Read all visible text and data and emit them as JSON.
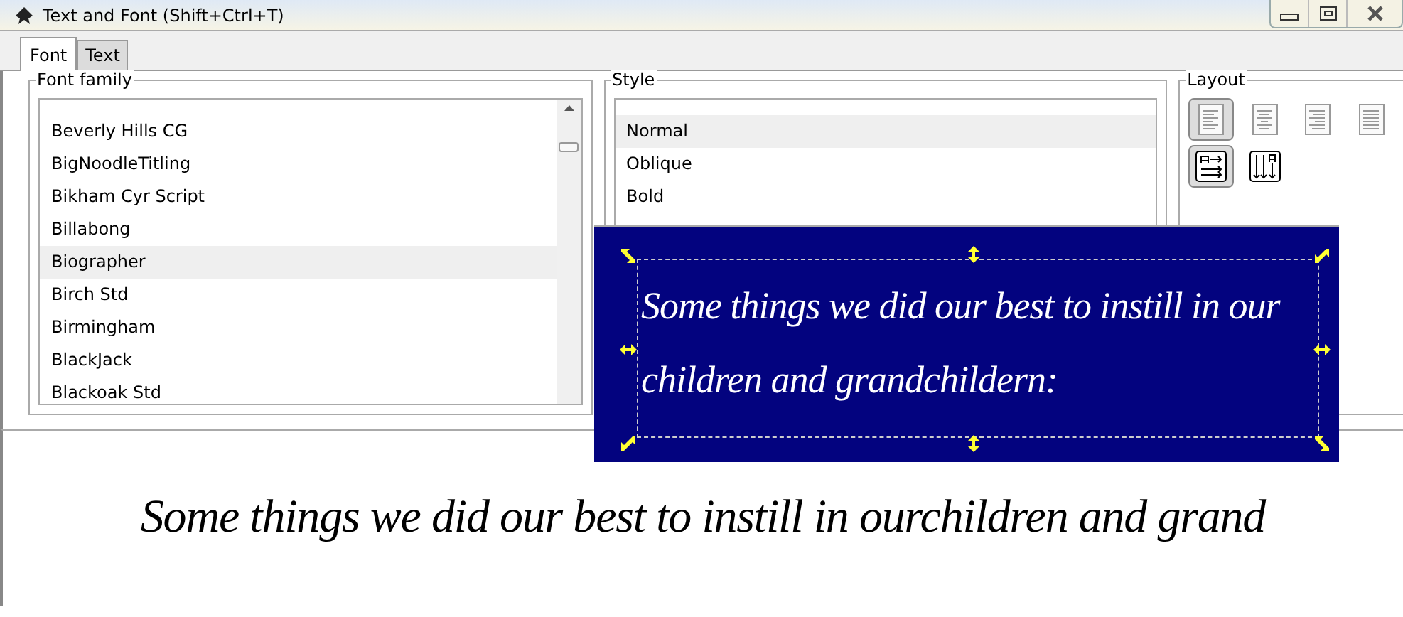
{
  "window": {
    "title": "Text and Font (Shift+Ctrl+T)"
  },
  "tabs": [
    {
      "label": "Font",
      "selected": true
    },
    {
      "label": "Text",
      "selected": false
    }
  ],
  "font_family": {
    "label": "Font family",
    "items": [
      {
        "label": "Beverly Hills CG",
        "selected": false
      },
      {
        "label": "BigNoodleTitling",
        "selected": false
      },
      {
        "label": "Bikham Cyr Script",
        "selected": false
      },
      {
        "label": "Billabong",
        "selected": false
      },
      {
        "label": "Biographer",
        "selected": true
      },
      {
        "label": "Birch Std",
        "selected": false
      },
      {
        "label": "Birmingham",
        "selected": false
      },
      {
        "label": "BlackJack",
        "selected": false
      },
      {
        "label": "Blackoak Std",
        "selected": false
      }
    ]
  },
  "style": {
    "label": "Style",
    "items": [
      {
        "label": "Normal",
        "selected": true
      },
      {
        "label": "Oblique",
        "selected": false
      },
      {
        "label": "Bold",
        "selected": false
      }
    ]
  },
  "layout": {
    "label": "Layout",
    "alignment": [
      {
        "kind": "left",
        "selected": true
      },
      {
        "kind": "center",
        "selected": false
      },
      {
        "kind": "right",
        "selected": false
      },
      {
        "kind": "justify",
        "selected": false
      }
    ],
    "orientation": [
      {
        "kind": "horizontal",
        "selected": true
      },
      {
        "kind": "vertical",
        "selected": false
      }
    ]
  },
  "canvas_overlay": {
    "lines": [
      "Some things we did our best to instill in our",
      "children and grandchildern:"
    ]
  },
  "preview": {
    "text": "Some things we did our best to instill in ourchildren and grand"
  }
}
